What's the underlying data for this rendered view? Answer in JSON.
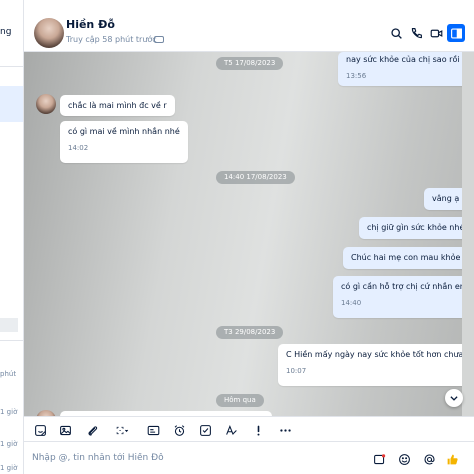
{
  "sidebar_fragments": {
    "top_text": "ng",
    "time_1": "phút",
    "time_2": "1 giờ",
    "time_3": "1 giờ",
    "time_4": "1 giờ"
  },
  "header": {
    "name": "Hiền Đỗ",
    "status": "Truy cập 58 phút trước"
  },
  "dates": {
    "d1": "T5 17/08/2023",
    "d2": "14:40 17/08/2023",
    "d3": "T3 29/08/2023",
    "d4": "Hôm qua"
  },
  "messages": [
    {
      "text": "nay sức khỏe của chị sao rồi ạ",
      "time": "13:56",
      "mine": true
    },
    {
      "text": "chắc là mai mình đc về r",
      "mine": false
    },
    {
      "text": "có gì mai về mình nhắn nhé",
      "time": "14:02",
      "mine": false
    },
    {
      "text": "vâng ạ",
      "mine": true
    },
    {
      "text": "chị giữ gìn sức khỏe nhé",
      "mine": true
    },
    {
      "text": "Chúc hai mẹ con mau khỏe ạ",
      "mine": true
    },
    {
      "text": "có gì cần hỗ trợ chị cứ nhắn em",
      "time": "14:40",
      "mine": true
    },
    {
      "text": "C Hiền mấy ngày nay sức khỏe tốt hơn chưa ạ",
      "time": "10:07",
      "mine": false
    }
  ],
  "toolbar": {
    "icons": [
      "sticker-icon",
      "image-icon",
      "attachment-icon",
      "screenshot-icon",
      "contact-card-icon",
      "reminder-icon",
      "task-icon",
      "format-text-icon",
      "urgent-icon",
      "more-icon"
    ]
  },
  "composer": {
    "placeholder": "Nhập @, tin nhắn tới Hiền Đỗ"
  },
  "colors": {
    "accent": "#0068ff",
    "my_bubble": "#e5efff",
    "their_bubble": "#ffffff"
  }
}
